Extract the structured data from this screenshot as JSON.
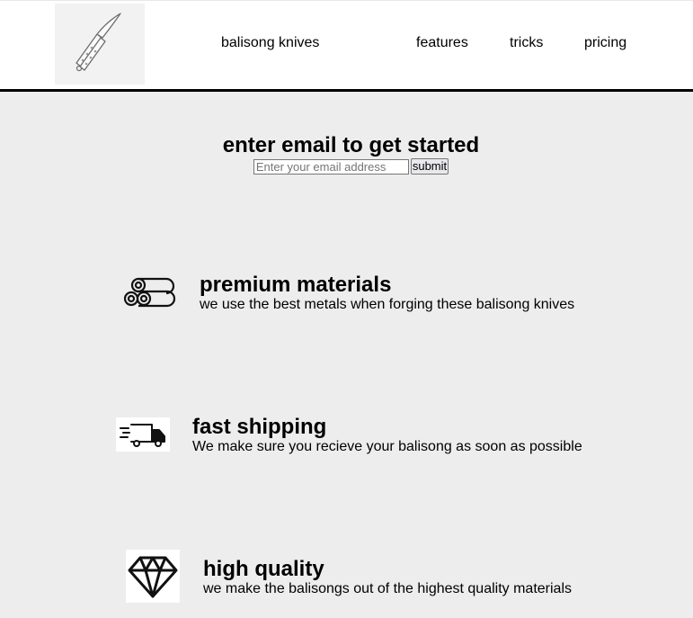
{
  "header": {
    "brand": "balisong knives",
    "nav": [
      "features",
      "tricks",
      "pricing"
    ]
  },
  "signup": {
    "heading": "enter email to get started",
    "email_placeholder": "Enter your email address",
    "submit_label": "submit"
  },
  "features": [
    {
      "icon": "metal-pipes-icon",
      "title": "premium materials",
      "description": "we use the best metals when forging these balisong knives"
    },
    {
      "icon": "delivery-truck-icon",
      "title": "fast shipping",
      "description": "We make sure you recieve your balisong as soon as possible"
    },
    {
      "icon": "diamond-icon",
      "title": "high quality",
      "description": "we make the balisongs out of the highest quality materials"
    }
  ]
}
